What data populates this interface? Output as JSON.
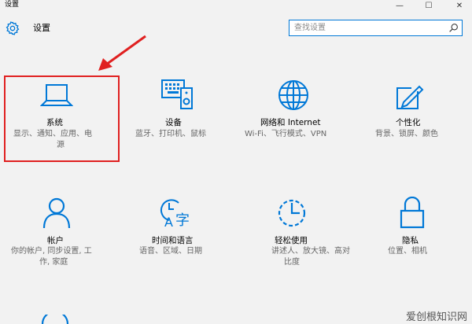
{
  "window": {
    "title": "设置",
    "minimize_glyph": "—",
    "maximize_glyph": "☐",
    "close_glyph": "✕"
  },
  "header": {
    "title": "设置",
    "gear_icon": "gear-icon"
  },
  "search": {
    "placeholder": "查找设置",
    "value": ""
  },
  "accent_color": "#0078d7",
  "highlight_color": "#e02020",
  "tiles": [
    {
      "key": "system",
      "label": "系统",
      "desc_lines": [
        "显示、通知、应用、电",
        "源"
      ],
      "icon": "laptop-icon"
    },
    {
      "key": "devices",
      "label": "设备",
      "desc_lines": [
        "蓝牙、打印机、鼠标"
      ],
      "icon": "devices-icon"
    },
    {
      "key": "network",
      "label": "网络和 Internet",
      "desc_lines": [
        "Wi-Fi、飞行模式、VPN"
      ],
      "icon": "globe-icon"
    },
    {
      "key": "personalization",
      "label": "个性化",
      "desc_lines": [
        "背景、锁屏、颜色"
      ],
      "icon": "personalization-icon"
    },
    {
      "key": "accounts",
      "label": "帐户",
      "desc_lines": [
        "你的帐户, 同步设置, 工",
        "作, 家庭"
      ],
      "icon": "person-icon"
    },
    {
      "key": "time_language",
      "label": "时间和语言",
      "desc_lines": [
        "语音、区域、日期"
      ],
      "icon": "time-language-icon"
    },
    {
      "key": "ease_of_access",
      "label": "轻松使用",
      "desc_lines": [
        "讲述人、放大镜、高对",
        "比度"
      ],
      "icon": "ease-of-access-icon"
    },
    {
      "key": "privacy",
      "label": "隐私",
      "desc_lines": [
        "位置、相机"
      ],
      "icon": "lock-icon"
    }
  ],
  "watermark": "爱创根知识网"
}
